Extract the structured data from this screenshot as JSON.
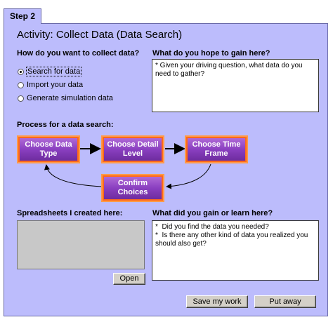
{
  "tab": {
    "label": "Step 2"
  },
  "activity": {
    "title": "Activity: Collect Data (Data Search)"
  },
  "collect": {
    "question": "How do you want to collect data?",
    "options": [
      {
        "label": "Search for data",
        "checked": true
      },
      {
        "label": "Import your data",
        "checked": false
      },
      {
        "label": "Generate simulation data",
        "checked": false
      }
    ]
  },
  "hope": {
    "question": "What do you hope to gain here?",
    "text": "* Given your driving question, what data do you need to gather?"
  },
  "process": {
    "label": "Process for a data search:",
    "steps": [
      "Choose Data Type",
      "Choose Detail Level",
      "Choose Time Frame",
      "Confirm Choices"
    ]
  },
  "spreadsheets": {
    "label": "Spreadsheets I created here:",
    "open_label": "Open"
  },
  "learn": {
    "question": "What did you gain or learn here?",
    "text": "*  Did you find the data you needed?\n*  Is there any other kind of data you realized you should also get?"
  },
  "actions": {
    "save_label": "Save my work",
    "putaway_label": "Put away"
  },
  "colors": {
    "panel": "#bcbcfc",
    "button_orange": "#ff9a4a",
    "button_purple": "#8a3fc0"
  }
}
